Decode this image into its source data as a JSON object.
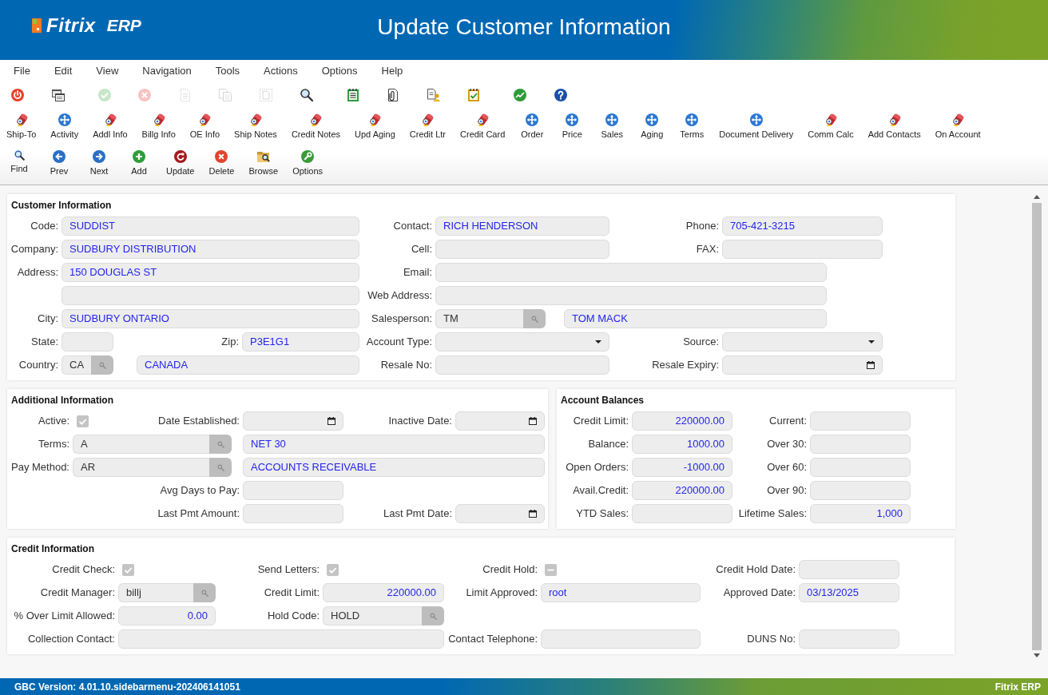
{
  "header": {
    "logo_name": "Fitrix",
    "logo_suffix": "ERP",
    "title": "Update Customer Information"
  },
  "menu": [
    "File",
    "Edit",
    "View",
    "Navigation",
    "Tools",
    "Actions",
    "Options",
    "Help"
  ],
  "toolbar_groups": [
    [
      {
        "kind": "power",
        "disabled": false
      },
      {
        "kind": "window",
        "disabled": false
      }
    ],
    [
      {
        "kind": "accept",
        "disabled": true
      },
      {
        "kind": "cancel",
        "disabled": true
      },
      {
        "kind": "document",
        "disabled": true
      },
      {
        "kind": "copy",
        "disabled": true
      },
      {
        "kind": "select",
        "disabled": true
      },
      {
        "kind": "zoom",
        "disabled": false
      }
    ],
    [
      {
        "kind": "notepad",
        "disabled": false
      },
      {
        "kind": "attachment",
        "disabled": false
      },
      {
        "kind": "person-document",
        "disabled": false
      },
      {
        "kind": "checklist",
        "disabled": false
      }
    ],
    [
      {
        "kind": "chart",
        "disabled": false
      },
      {
        "kind": "help",
        "disabled": false
      }
    ]
  ],
  "actions": [
    {
      "label": "Ship-To",
      "kind": "device"
    },
    {
      "label": "Activity",
      "kind": "navigate"
    },
    {
      "label": "Addl Info",
      "kind": "device"
    },
    {
      "label": "Billg Info",
      "kind": "device"
    },
    {
      "label": "OE Info",
      "kind": "device"
    },
    {
      "label": "Ship Notes",
      "kind": "device"
    },
    {
      "label": "Credit Notes",
      "kind": "device"
    },
    {
      "label": "Upd Aging",
      "kind": "device"
    },
    {
      "label": "Credit Ltr",
      "kind": "device"
    },
    {
      "label": "Credit Card",
      "kind": "device"
    },
    {
      "label": "Order",
      "kind": "navigate"
    },
    {
      "label": "Price",
      "kind": "navigate"
    },
    {
      "label": "Sales",
      "kind": "navigate"
    },
    {
      "label": "Aging",
      "kind": "navigate"
    },
    {
      "label": "Terms",
      "kind": "navigate"
    },
    {
      "label": "Document Delivery",
      "kind": "navigate"
    },
    {
      "label": "Comm Calc",
      "kind": "device"
    },
    {
      "label": "Add Contacts",
      "kind": "device"
    },
    {
      "label": "On Account",
      "kind": "device"
    }
  ],
  "navigation": [
    {
      "label": "Find",
      "kind": "find"
    },
    {
      "label": "Prev",
      "kind": "prev"
    },
    {
      "label": "Next",
      "kind": "next"
    },
    {
      "label": "Add",
      "kind": "add"
    },
    {
      "label": "Update",
      "kind": "update"
    },
    {
      "label": "Delete",
      "kind": "delete"
    },
    {
      "label": "Browse",
      "kind": "browse"
    },
    {
      "label": "Options",
      "kind": "options"
    }
  ],
  "customer_information": {
    "title": "Customer Information",
    "fields": [
      {
        "label": "Code:",
        "kind": "text",
        "value": "SUDDIST"
      },
      {
        "label": "Contact:",
        "kind": "text",
        "value": "RICH HENDERSON"
      },
      {
        "label": "Phone:",
        "kind": "text",
        "value": "705-421-3215"
      },
      {
        "label": "Company:",
        "kind": "text",
        "value": "SUDBURY DISTRIBUTION"
      },
      {
        "label": "Cell:",
        "kind": "text"
      },
      {
        "label": "FAX:",
        "kind": "text"
      },
      {
        "label": "Address:",
        "kind": "text",
        "value": "150 DOUGLAS ST"
      },
      {
        "label": "Email:",
        "kind": "text"
      },
      {
        "kind": "text"
      },
      {
        "label": "Web Address:",
        "kind": "text"
      },
      {
        "label": "City:",
        "kind": "text",
        "value": "SUDBURY ONTARIO"
      },
      {
        "label": "Salesperson:",
        "kind": "lookup",
        "value": "TM"
      },
      {
        "kind": "text",
        "value": "TOM MACK"
      },
      {
        "label": "State:",
        "kind": "text"
      },
      {
        "label": "Zip:",
        "kind": "text",
        "value": "P3E1G1"
      },
      {
        "label": "Account Type:",
        "kind": "select"
      },
      {
        "label": "Source:",
        "kind": "select"
      },
      {
        "label": "Country:",
        "kind": "lookup",
        "value": "CA"
      },
      {
        "kind": "text",
        "value": "CANADA"
      },
      {
        "label": "Resale No:",
        "kind": "text"
      },
      {
        "label": "Resale Expiry:",
        "kind": "date"
      }
    ]
  },
  "additional_information": {
    "title": "Additional Information",
    "fields": [
      {
        "label": "Active:",
        "kind": "check",
        "checked": true,
        "indeterminate": false
      },
      {
        "label": "Date Established:",
        "kind": "date"
      },
      {
        "label": "Inactive Date:",
        "kind": "date"
      },
      {
        "label": "Terms:",
        "kind": "lookup",
        "value": "A"
      },
      {
        "kind": "text",
        "value": "NET 30"
      },
      {
        "label": "Pay Method:",
        "kind": "lookup",
        "value": "AR"
      },
      {
        "kind": "text",
        "value": "ACCOUNTS RECEIVABLE"
      },
      {
        "label": "Avg Days to Pay:",
        "kind": "text"
      },
      {
        "label": "Last Pmt Amount:",
        "kind": "text"
      },
      {
        "label": "Last Pmt Date:",
        "kind": "date"
      }
    ]
  },
  "account_balances": {
    "title": "Account Balances",
    "fields": [
      {
        "label": "Credit Limit:",
        "kind": "amount",
        "value": "220000.00"
      },
      {
        "label": "Current:",
        "kind": "amount"
      },
      {
        "label": "Balance:",
        "kind": "amount",
        "value": "1000.00"
      },
      {
        "label": "Over 30:",
        "kind": "amount"
      },
      {
        "label": "Open Orders:",
        "kind": "amount",
        "value": "-1000.00"
      },
      {
        "label": "Over 60:",
        "kind": "amount"
      },
      {
        "label": "Avail.Credit:",
        "kind": "amount",
        "value": "220000.00"
      },
      {
        "label": "Over 90:",
        "kind": "amount"
      },
      {
        "label": "YTD Sales:",
        "kind": "amount"
      },
      {
        "label": "Lifetime Sales:",
        "kind": "amount",
        "value": "1,000"
      }
    ]
  },
  "credit_information": {
    "title": "Credit Information",
    "fields": [
      {
        "label": "Credit Check:",
        "kind": "check",
        "checked": true,
        "indeterminate": false
      },
      {
        "label": "Send Letters:",
        "kind": "check",
        "checked": true,
        "indeterminate": false
      },
      {
        "label": "Credit Hold:",
        "kind": "check",
        "checked": false,
        "indeterminate": true
      },
      {
        "label": "Credit Hold Date:",
        "kind": "text"
      },
      {
        "label": "Credit Manager:",
        "kind": "lookup",
        "value": "billj"
      },
      {
        "label": "Credit Limit:",
        "kind": "amount",
        "value": "220000.00"
      },
      {
        "label": "Limit Approved:",
        "kind": "text",
        "value": "root"
      },
      {
        "label": "Approved Date:",
        "kind": "text",
        "value": "03/13/2025"
      },
      {
        "label": "% Over Limit Allowed:",
        "kind": "amount",
        "value": "0.00"
      },
      {
        "label": "Hold Code:",
        "kind": "lookup",
        "value": "HOLD"
      },
      {
        "label": "Collection Contact:",
        "kind": "text"
      },
      {
        "label": "Contact Telephone:",
        "kind": "text"
      },
      {
        "label": "DUNS No:",
        "kind": "text"
      }
    ]
  },
  "status_bar": {
    "version": "GBC Version: 4.01.10.sidebarmenu-202406141051",
    "product": "Fitrix ERP"
  }
}
